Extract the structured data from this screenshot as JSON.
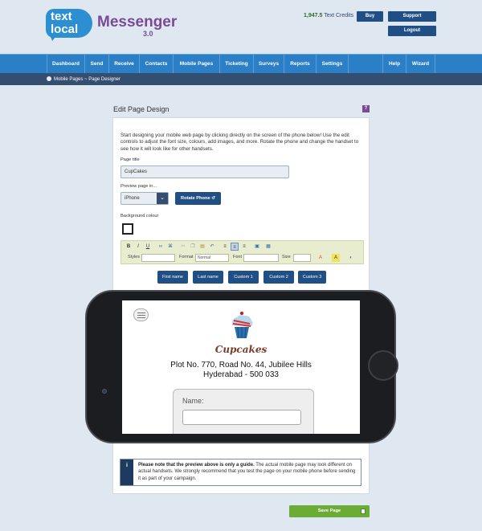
{
  "header": {
    "logo_line1": "text",
    "logo_line2": "local",
    "app_name": "Messenger",
    "app_version": "3.0",
    "credits_value": "1,947.5",
    "credits_label": "Text Credits",
    "buy_label": "Buy",
    "support_label": "Support",
    "logout_label": "Logout"
  },
  "nav": {
    "items": [
      "Dashboard",
      "Send",
      "Receive",
      "Contacts",
      "Mobile Pages",
      "Ticketing",
      "Surveys",
      "Reports",
      "Settings",
      "Help",
      "Wizard"
    ]
  },
  "breadcrumb": "Mobile Pages ~ Page Designer",
  "panel": {
    "title": "Edit Page Design",
    "help": "?",
    "intro": "Start designing your mobile web page by clicking directly on the screen of the phone below! Use the edit controls to adjust the font size, colours, add images, and more. Rotate the phone and change the handset to see how it will look like for other handsets.",
    "page_title_label": "Page title",
    "page_title_value": "CupCakes",
    "preview_label": "Preview page in...",
    "preview_value": "iPhone",
    "rotate_label": "Rotate Phone",
    "bg_label": "Background colour",
    "bg_color": "#ffffff"
  },
  "toolbar": {
    "bold": "B",
    "italic": "I",
    "underline": "U",
    "styles_label": "Styles",
    "format_label": "Format",
    "format_value": "Normal",
    "font_label": "Font",
    "size_label": "Size"
  },
  "field_buttons": [
    "First name",
    "Last name",
    "Custom 1",
    "Custom 2",
    "Custom 3"
  ],
  "preview": {
    "brand": "Cupcakes",
    "address_line1": "Plot No. 770, Road No. 44, Jubilee Hills",
    "address_line2": "Hyderabad - 500 033",
    "form_label": "Name:"
  },
  "notice": {
    "icon": "i",
    "bold": "Please note that the preview above is only a guide.",
    "text": " The actual mobile page may look different on actual handsets. We strongly recommend that you test the page on your mobile phone before sending it as part of your campaign."
  },
  "save_label": "Save Page",
  "colors": {
    "nav_blue": "#2a7fc6",
    "dark_blue": "#1f4f84",
    "save_green": "#6aac36",
    "brand_purple": "#7a4a95"
  }
}
